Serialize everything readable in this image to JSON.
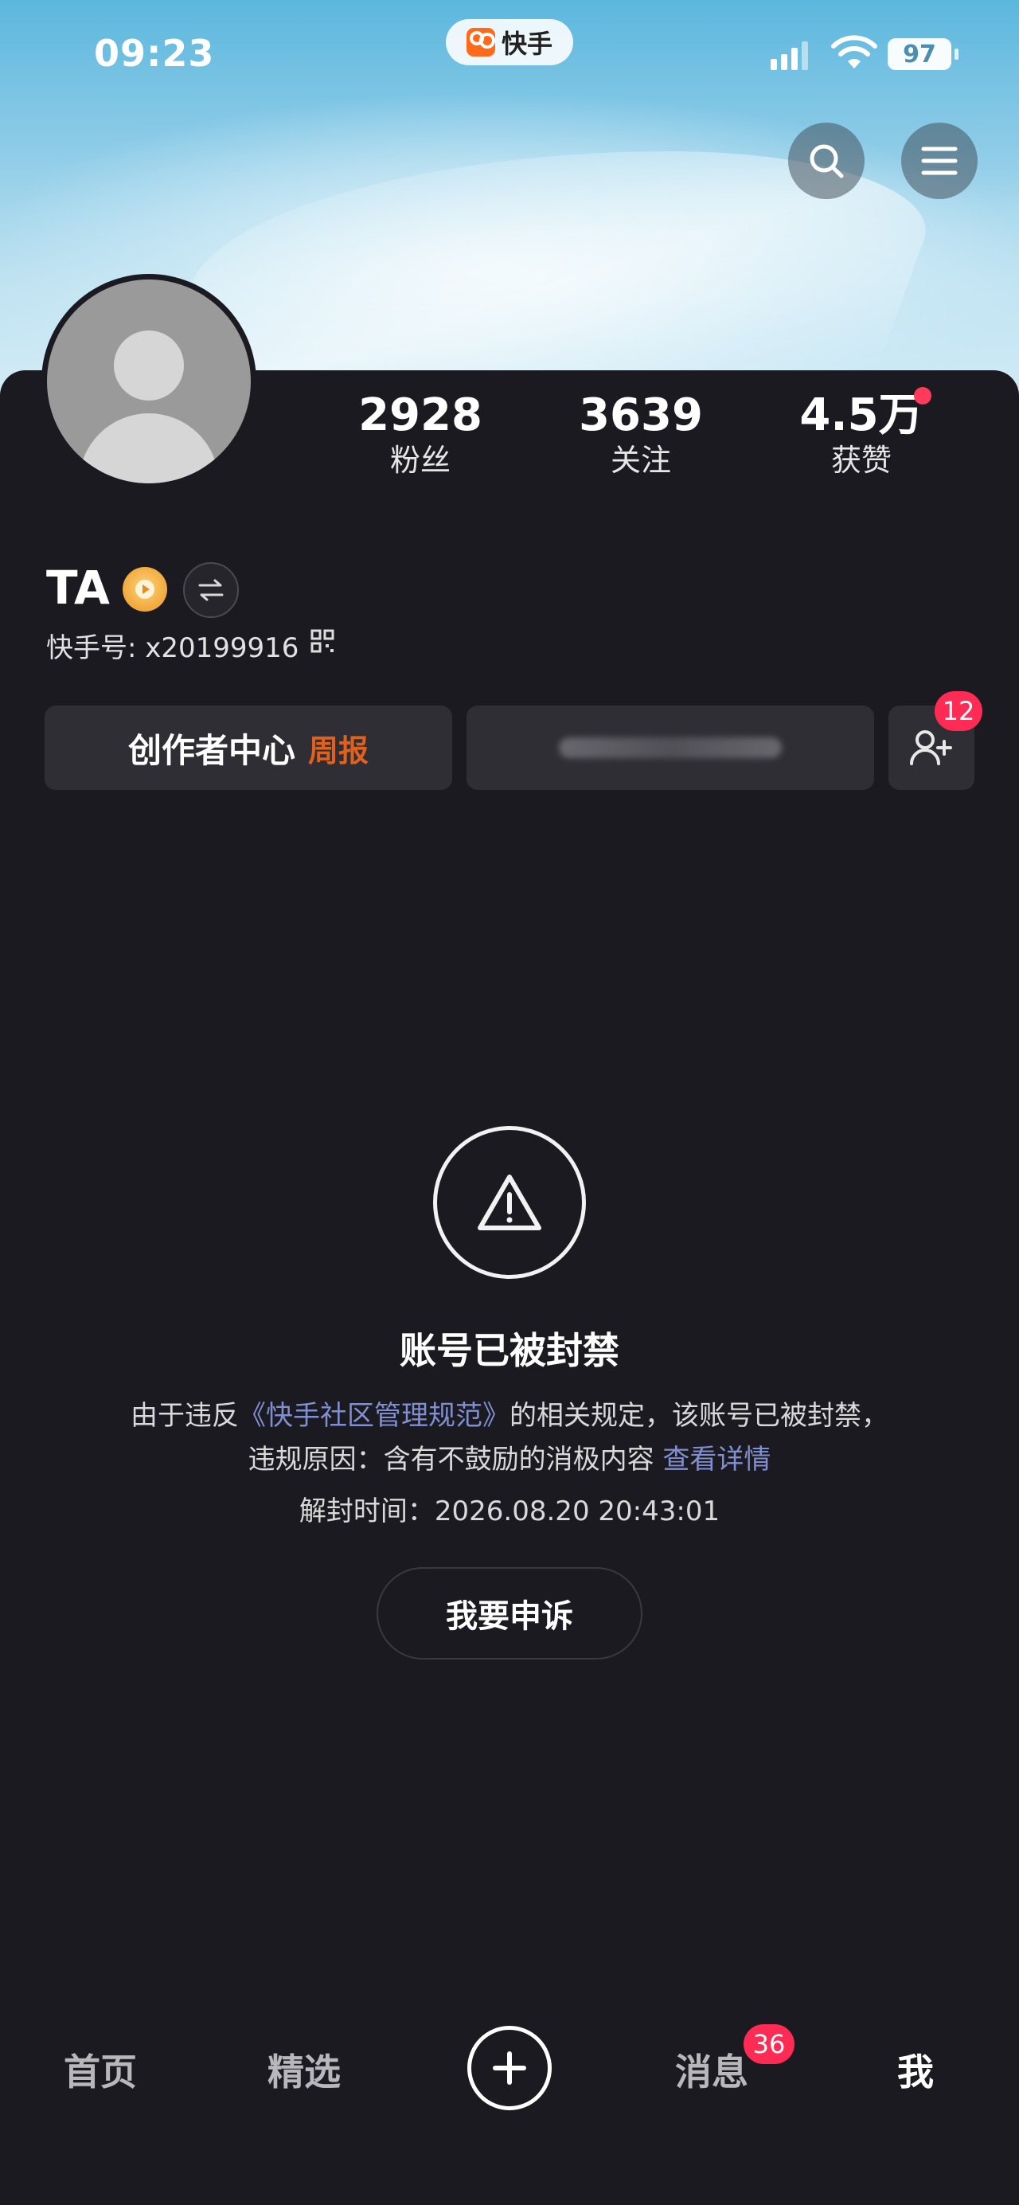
{
  "status_bar": {
    "time": "09:23",
    "app_name": "快手",
    "battery": "97"
  },
  "profile": {
    "username": "TA",
    "account_id": "快手号: x20199916",
    "stats": [
      {
        "value": "2928",
        "label": "粉丝"
      },
      {
        "value": "3639",
        "label": "关注"
      },
      {
        "value": "4.5万",
        "label": "获赞"
      }
    ]
  },
  "actions": {
    "creator_center": "创作者中心",
    "weekly_report": "周报",
    "friend_badge_count": "12"
  },
  "ban_notice": {
    "title": "账号已被封禁",
    "line1_prefix": "由于违反",
    "line1_link": "《快手社区管理规范》",
    "line1_suffix": "的相关规定，该账号已被封禁，",
    "line2_prefix": "违规原因：含有不鼓励的消极内容 ",
    "line2_link": "查看详情",
    "unban_time": "解封时间：2026.08.20 20:43:01",
    "appeal_button": "我要申诉"
  },
  "bottom_nav": {
    "home": "首页",
    "featured": "精选",
    "messages": "消息",
    "messages_badge": "36",
    "me": "我"
  },
  "colors": {
    "background": "#1b1a21",
    "badge_red": "#fe2c55",
    "link_blue": "#7f8fd0",
    "weekly_orange": "#e0601d"
  }
}
